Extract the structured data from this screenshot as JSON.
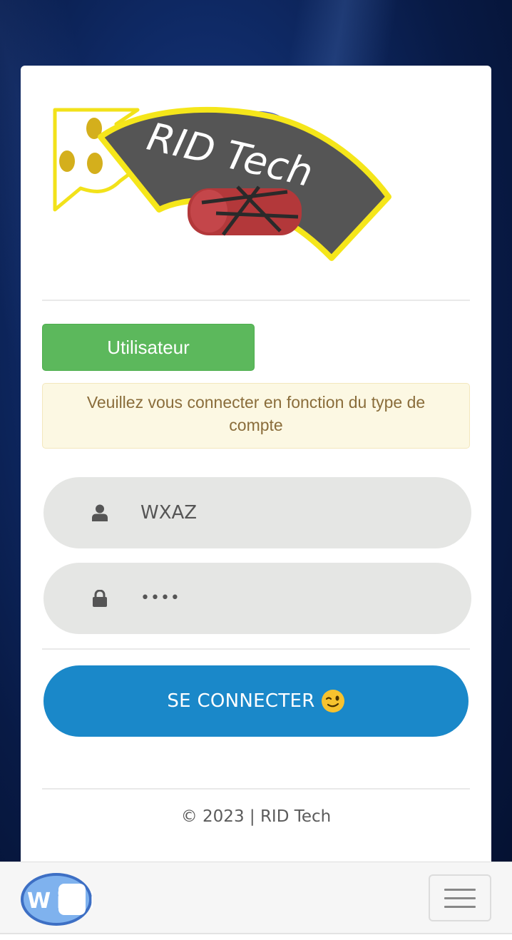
{
  "brand": {
    "logo_text": "RID Tech"
  },
  "login": {
    "user_type_label": "Utilisateur",
    "alert_text": "Veuillez vous connecter en fonction du type de compte",
    "username_value": "WXAZ",
    "password_value": "••••",
    "submit_label": "SE CONNECTER"
  },
  "footer": {
    "copyright": "© 2023 | RID Tech"
  },
  "navbar": {
    "logo_text": "WiFi"
  },
  "colors": {
    "primary_blue": "#1a88c9",
    "success_green": "#5cb85c",
    "warning_bg": "#fcf8e3",
    "warning_text": "#8a6d3b"
  }
}
